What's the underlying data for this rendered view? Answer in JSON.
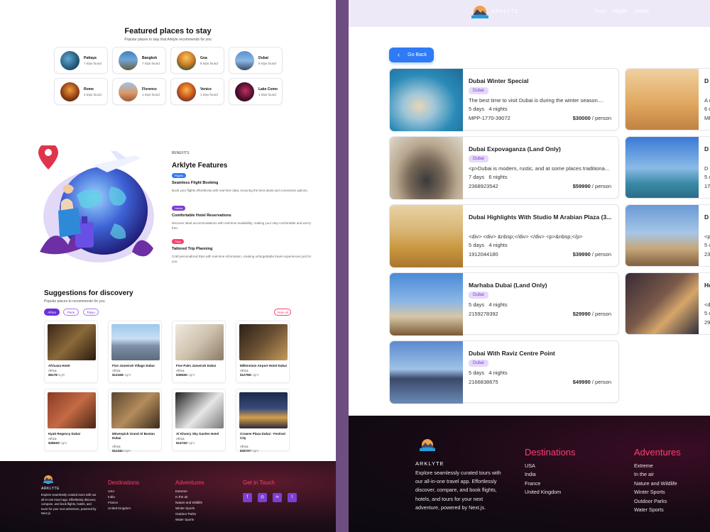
{
  "left": {
    "featured": {
      "title": "Featured places to stay",
      "subtitle": "Popular places to stay that Arklyte recommends for you",
      "places": [
        {
          "name": "Pattaya",
          "trips": "7 trips found"
        },
        {
          "name": "Bangkok",
          "trips": "7 trips found"
        },
        {
          "name": "Goa",
          "trips": "8 trips found"
        },
        {
          "name": "Dubai",
          "trips": "9 trips found"
        },
        {
          "name": "Rome",
          "trips": "2 trips found"
        },
        {
          "name": "Florence",
          "trips": "1 trips found"
        },
        {
          "name": "Venice",
          "trips": "1 trips found"
        },
        {
          "name": "Lake Como",
          "trips": "1 trips found"
        }
      ]
    },
    "benefits": {
      "eyebrow": "BENEFITS",
      "title": "Arklyte Features",
      "features": [
        {
          "tag": "Flights",
          "tag_color": "#2f7bf6",
          "title": "Seamless Flight Booking",
          "text": "Book your flights effortlessly with real-time data, ensuring the best deals and convenient options."
        },
        {
          "tag": "Hotels",
          "tag_color": "#7b3fd1",
          "title": "Comfortable Hotel Reservations",
          "text": "Discover ideal accommodations with real-time availability, making your stay comfortable and worry-free."
        },
        {
          "tag": "Trips",
          "tag_color": "#ff3d6e",
          "title": "Tailored Trip Planning",
          "text": "Craft personalized trips with real-time information, creating unforgettable travel experiences just for you."
        }
      ]
    },
    "suggestions": {
      "title": "Suggestions for discovery",
      "subtitle": "Popular places to recommends for you",
      "chips": [
        "Africa",
        "Paris",
        "Tokyo"
      ],
      "view_all": "View all",
      "per_night": "/night",
      "hotels": [
        {
          "name": "Africana Hotel",
          "region": "Africa",
          "price": "$8178"
        },
        {
          "name": "Five Jumeirah Village Dubai",
          "region": "Africa",
          "price": "$12168"
        },
        {
          "name": "Five Palm Jumeirah Dubai",
          "region": "Africa",
          "price": "$35536"
        },
        {
          "name": "Millennium Airport Hotel Dubai",
          "region": "Africa",
          "price": "$12798"
        },
        {
          "name": "Hyatt Regency Dubai",
          "region": "Africa",
          "price": "$28630"
        },
        {
          "name": "Mövenpick Grand Al Bustan Dubai",
          "region": "Africa",
          "price": "$11341"
        },
        {
          "name": "Al Khoory Sky Garden Hotel",
          "region": "Africa",
          "price": "$14740"
        },
        {
          "name": "Crowne Plaza Dubai - Festival City",
          "region": "Africa",
          "price": "$33737"
        }
      ]
    },
    "footer": {
      "brand": "ARKLYTE",
      "description": "Explore seamlessly curated tours with our all-in-one travel app. Effortlessly discover, compare, and book flights, hotels, and tours for your next adventure, powered by Next.js.",
      "destinations_title": "Destinations",
      "destinations": [
        "USA",
        "India",
        "France",
        "United Kingdom"
      ],
      "adventures_title": "Adventures",
      "adventures": [
        "Extreme",
        "In the air",
        "Nature and Wildlife",
        "Winter Sports",
        "Outdoor Parks",
        "Water Sports"
      ],
      "contact_title": "Get in Touch",
      "social": [
        "f",
        "◎",
        "in",
        "t"
      ]
    }
  },
  "right": {
    "header": {
      "brand": "ARKLYTE",
      "nav": [
        "Tours",
        "Flights",
        "Hotels"
      ]
    },
    "go_back": "Go Back",
    "tours": [
      {
        "title": "Dubai Winter Special",
        "tag": "Dubai",
        "desc": "The best time to visit Dubai is during the winter season....",
        "days": "5 days",
        "nights": "4 nights",
        "code": "MPP-1770-39072",
        "price": "$30000",
        "per": "/ person"
      },
      {
        "title": "Dubai Expovaganza (Land Only)",
        "tag": "Dubai",
        "desc": "<p>Dubai is modern, rustic, and at some places traditiona...",
        "days": "7 days",
        "nights": "6 nights",
        "code": "2368923542",
        "price": "$59990",
        "per": "/ person"
      },
      {
        "title": "Dubai Highlights With Studio M Arabian Plaza (3...",
        "tag": "",
        "desc": "<div> <div> &nbsp;</div> </div> <p>&nbsp;</p>",
        "days": "5 days",
        "nights": "4 nights",
        "code": "1912044180",
        "price": "$39990",
        "per": "/ person"
      },
      {
        "title": "Marhaba Dubai (Land Only)",
        "tag": "Dubai",
        "desc": "",
        "days": "5 days",
        "nights": "4 nights",
        "code": "2159278392",
        "price": "$29990",
        "per": "/ person"
      },
      {
        "title": "Dubai With Raviz Centre Point",
        "tag": "Dubai",
        "desc": "",
        "days": "5 days",
        "nights": "4 nights",
        "code": "2166838675",
        "price": "$49990",
        "per": "/ person"
      }
    ],
    "partial_tours": [
      {
        "title": "D",
        "lines": [
          "A c",
          "6 d",
          "MF"
        ]
      },
      {
        "title": "D",
        "lines": [
          "D",
          "5 c",
          "172"
        ]
      },
      {
        "title": "D",
        "lines": [
          "<p",
          "5 c",
          "23"
        ]
      },
      {
        "title": "Ho",
        "lines": [
          "<d",
          "5 d",
          "29"
        ]
      }
    ],
    "footer": {
      "brand": "ARKLYTE",
      "description": "Explore seamlessly curated tours with our all-in-one travel app. Effortlessly discover, compare, and book flights, hotels, and tours for your next adventure, powered by Next.js.",
      "destinations_title": "Destinations",
      "destinations": [
        "USA",
        "India",
        "France",
        "United Kingdom"
      ],
      "adventures_title": "Adventures",
      "adventures": [
        "Extreme",
        "In the air",
        "Nature and Wildlife",
        "Winter Sports",
        "Outdoor Parks",
        "Water Sports"
      ]
    }
  }
}
